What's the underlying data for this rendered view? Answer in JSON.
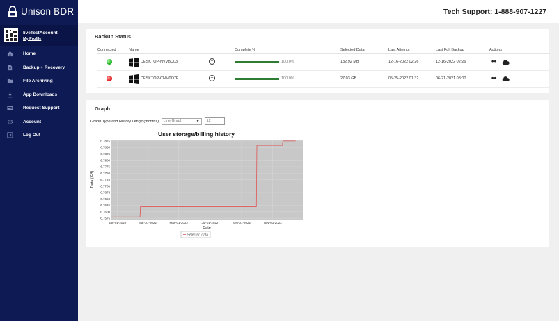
{
  "brand": {
    "name": "Unison BDR"
  },
  "account": {
    "name": "liveTestAccount",
    "profile_link": "My Profile"
  },
  "nav": [
    {
      "label": "Home",
      "icon": "home-icon"
    },
    {
      "label": "Backup + Recovery",
      "icon": "backup-icon"
    },
    {
      "label": "File Archiving",
      "icon": "folder-icon"
    },
    {
      "label": "App Downloads",
      "icon": "download-icon"
    },
    {
      "label": "Request Support",
      "icon": "id-card-icon"
    },
    {
      "label": "Account",
      "icon": "gear-icon"
    },
    {
      "label": "Log Out",
      "icon": "logout-icon"
    }
  ],
  "header": {
    "support": "Tech Support: 1-888-907-1227"
  },
  "backup": {
    "title": "Backup Status",
    "columns": [
      "Connected",
      "Name",
      "Complete %",
      "Selected Data",
      "Last Attempt",
      "Last Full Backup",
      "Actions"
    ],
    "rows": [
      {
        "status": "connected",
        "name": "DESKTOP-NVVBU03",
        "complete": 1.0,
        "complete_text": "100.0%",
        "selected": "132.92 MB",
        "last_attempt": "12-16-2022 02:26",
        "last_full": "12-16-2022 02:26"
      },
      {
        "status": "disconnected",
        "name": "DESKTOP-CNM0O7F",
        "complete": 1.0,
        "complete_text": "100.0%",
        "selected": "27.03 GB",
        "last_attempt": "05-25-2022 01:32",
        "last_full": "06-21-2021 08:00"
      }
    ]
  },
  "graph": {
    "title": "Graph",
    "type_label": "Graph Type and History Length(months):",
    "type_value": "Line Graph",
    "months_value": "12"
  },
  "chart_data": {
    "type": "line",
    "title": "User storage/billing history",
    "xlabel": "Date",
    "ylabel": "Data (GB)",
    "x_ticks": [
      "Jan-01-2022",
      "Mar-01-2022",
      "May-01-2022",
      "Jul-01-2022",
      "Sep-01-2022",
      "Nov-01-2022"
    ],
    "y_ticks": [
      "6.7575",
      "6.7600",
      "6.7625",
      "6.7650",
      "6.7675",
      "6.7700",
      "6.7725",
      "6.7750",
      "6.7775",
      "6.7800",
      "6.7825",
      "6.7850",
      "6.7875"
    ],
    "ylim": [
      6.757,
      6.788
    ],
    "x": [
      "2021-12-20",
      "2022-02-14",
      "2022-02-15",
      "2022-09-30",
      "2022-10-01",
      "2022-11-20",
      "2022-11-21",
      "2022-12-16"
    ],
    "series": [
      {
        "name": "Selected data",
        "color": "#e05555",
        "values": [
          6.758,
          6.758,
          6.762,
          6.762,
          6.7858,
          6.7858,
          6.7875,
          6.7875
        ]
      }
    ],
    "legend": "bottom-center",
    "plot_background": "#c8c8c8",
    "grid": true
  },
  "colors": {
    "sidebar": "#0d1a54",
    "progress": "#2e7d32",
    "connected": "#25b325",
    "disconnected": "#e02020"
  }
}
